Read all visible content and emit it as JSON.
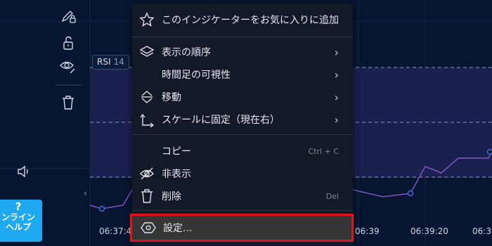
{
  "chart": {
    "indicator_name": "RSI",
    "indicator_value": "14",
    "time_labels": [
      "06:37:4",
      "06:39",
      "06:39:20",
      "06:39"
    ],
    "scroll_arrow": "‹"
  },
  "help_button": {
    "mark": "?",
    "line1": "ンライン",
    "line2": "ヘルプ"
  },
  "context_menu": {
    "add_favorite": "このインジケーターをお気に入りに追加",
    "visual_order": "表示の順序",
    "timeframe_visibility": "時間足の可視性",
    "move": "移動",
    "pin_to_scale": "スケールに固定（現在右）",
    "copy": "コピー",
    "copy_shortcut": "Ctrl + C",
    "hide": "非表示",
    "delete": "削除",
    "delete_shortcut": "Del",
    "settings": "設定...",
    "submenu_arrow": "›"
  },
  "colors": {
    "background": "#071630",
    "rsi_band": "#1a2151",
    "rsi_line": "#7e57c2",
    "menu_bg": "#121a28",
    "highlight_border": "#e1141c",
    "help_bg": "#1fa9f0"
  }
}
